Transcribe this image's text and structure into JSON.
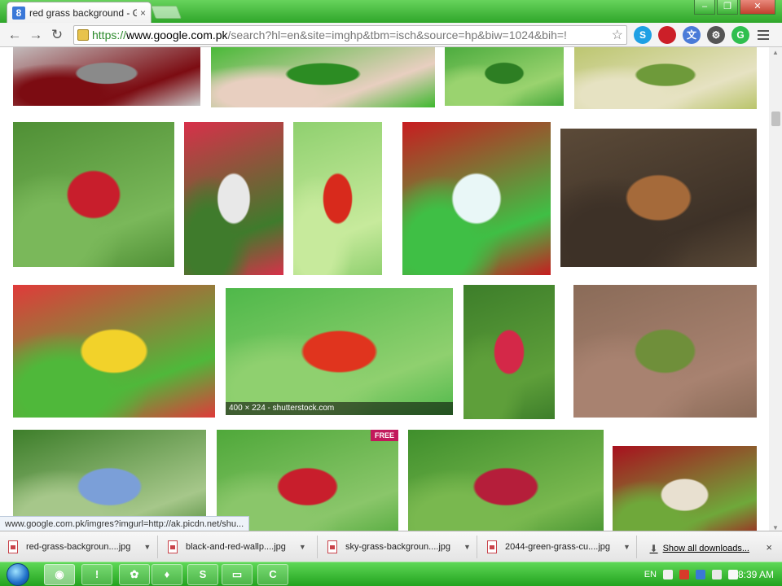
{
  "window": {
    "tab_title": "red grass background - Go",
    "tab_close": "×",
    "controls": {
      "minimize": "–",
      "maximize": "❐",
      "close": "✕"
    }
  },
  "toolbar": {
    "back": "←",
    "forward": "→",
    "reload": "↻",
    "url_protocol": "https://",
    "url_domain": "www.google.com.pk",
    "url_path": "/search?hl=en&site=imghp&tbm=isch&source=hp&biw=1024&bih=!",
    "star": "☆",
    "extensions": [
      {
        "name": "skype-icon",
        "label": "S",
        "color": "#1fa0e4"
      },
      {
        "name": "bookmark-red-icon",
        "label": "",
        "color": "#cc1f28"
      },
      {
        "name": "translate-icon",
        "label": "文",
        "color": "#4a7bd8"
      },
      {
        "name": "settings-wheel-icon",
        "label": "⚙",
        "color": "#555555"
      },
      {
        "name": "green-circle-icon",
        "label": "G",
        "color": "#2fbf4f"
      }
    ]
  },
  "results": {
    "hover_caption": "400 × 224 - shutterstock.com",
    "images": [
      {
        "name": "thumb-red-rose-grayscale",
        "colors": [
          "#c8c8c8",
          "#8a8a8a",
          "#7c0c12"
        ]
      },
      {
        "name": "thumb-hand-grass",
        "colors": [
          "#3fb82f",
          "#2c8c23",
          "#e8cfc0"
        ]
      },
      {
        "name": "thumb-green-lawn",
        "colors": [
          "#45a83a",
          "#2d7e23",
          "#9ad36f"
        ]
      },
      {
        "name": "thumb-tall-grass-field",
        "colors": [
          "#b9c46a",
          "#6e9a3a",
          "#e6e2c2"
        ]
      },
      {
        "name": "thumb-red-heart-grass",
        "colors": [
          "#4f8f35",
          "#c81e2c",
          "#7ab85a"
        ]
      },
      {
        "name": "thumb-strawberries-picnic",
        "colors": [
          "#d8304a",
          "#e8e8e8",
          "#3f7b2c"
        ]
      },
      {
        "name": "thumb-red-tulip",
        "colors": [
          "#8fd06f",
          "#d82a1c",
          "#c7ea9c"
        ]
      },
      {
        "name": "thumb-red-carpet-stairs",
        "colors": [
          "#c81c20",
          "#e9f7f7",
          "#3fbf45"
        ]
      },
      {
        "name": "thumb-fox-forest",
        "colors": [
          "#5b4a38",
          "#a56a3a",
          "#3d3127"
        ]
      },
      {
        "name": "thumb-strawberries-daisies",
        "colors": [
          "#e03a3a",
          "#f2d22a",
          "#4fb83a"
        ]
      },
      {
        "name": "thumb-tulip-meadow",
        "colors": [
          "#4fb84a",
          "#e0341e",
          "#8fd06f"
        ]
      },
      {
        "name": "thumb-grass-heart",
        "colors": [
          "#3d7e2a",
          "#d42848",
          "#5e9f3a"
        ]
      },
      {
        "name": "thumb-brick-moss",
        "colors": [
          "#8a6b58",
          "#6f8f3a",
          "#a88270"
        ]
      },
      {
        "name": "thumb-couple-park",
        "colors": [
          "#3d7e2a",
          "#7b9fd8",
          "#a6c78a"
        ]
      },
      {
        "name": "thumb-apple-grass-free",
        "colors": [
          "#4fa83a",
          "#c81e2c",
          "#8ac66a"
        ],
        "badge": "FREE"
      },
      {
        "name": "thumb-apple-meadow",
        "colors": [
          "#3f8f2c",
          "#b51e3a",
          "#79b84f"
        ]
      },
      {
        "name": "thumb-wine-flowers-red",
        "colors": [
          "#a8101e",
          "#e8e0d0",
          "#6fa83a"
        ]
      }
    ]
  },
  "status_url": "www.google.com.pk/imgres?imgurl=http://ak.picdn.net/shu...",
  "downloads": {
    "items": [
      {
        "label": "red-grass-backgroun....jpg"
      },
      {
        "label": "black-and-red-wallp....jpg"
      },
      {
        "label": "sky-grass-backgroun....jpg"
      },
      {
        "label": "2044-green-grass-cu....jpg"
      }
    ],
    "arrow": "▼",
    "show_all": "Show all downloads...",
    "close": "×"
  },
  "taskbar": {
    "apps": [
      {
        "name": "taskbar-chrome",
        "label": "◉",
        "active": true
      },
      {
        "name": "taskbar-app-2",
        "label": "!",
        "active": false
      },
      {
        "name": "taskbar-app-3",
        "label": "✿",
        "active": false
      },
      {
        "name": "taskbar-app-4",
        "label": "♦",
        "active": false
      },
      {
        "name": "taskbar-skype",
        "label": "S",
        "active": false
      },
      {
        "name": "taskbar-explorer",
        "label": "▭",
        "active": false
      },
      {
        "name": "taskbar-camtasia",
        "label": "C",
        "active": false
      }
    ],
    "language": "EN",
    "time": "8:39 AM"
  }
}
